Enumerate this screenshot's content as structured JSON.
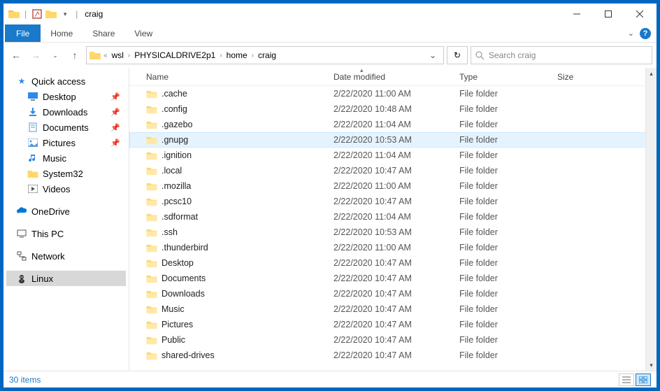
{
  "title": "craig",
  "ribbon": {
    "file": "File",
    "home": "Home",
    "share": "Share",
    "view": "View"
  },
  "breadcrumbs": [
    "wsl",
    "PHYSICALDRIVE2p1",
    "home",
    "craig"
  ],
  "search_placeholder": "Search craig",
  "columns": {
    "name": "Name",
    "date": "Date modified",
    "type": "Type",
    "size": "Size"
  },
  "nav": {
    "quick": "Quick access",
    "quick_items": [
      {
        "label": "Desktop",
        "pin": true,
        "icon": "desktop"
      },
      {
        "label": "Downloads",
        "pin": true,
        "icon": "downloads"
      },
      {
        "label": "Documents",
        "pin": true,
        "icon": "documents"
      },
      {
        "label": "Pictures",
        "pin": true,
        "icon": "pictures"
      },
      {
        "label": "Music",
        "pin": false,
        "icon": "music"
      },
      {
        "label": "System32",
        "pin": false,
        "icon": "folder"
      },
      {
        "label": "Videos",
        "pin": false,
        "icon": "videos"
      }
    ],
    "onedrive": "OneDrive",
    "thispc": "This PC",
    "network": "Network",
    "linux": "Linux"
  },
  "files": [
    {
      "name": ".cache",
      "date": "2/22/2020 11:00 AM",
      "type": "File folder"
    },
    {
      "name": ".config",
      "date": "2/22/2020 10:48 AM",
      "type": "File folder"
    },
    {
      "name": ".gazebo",
      "date": "2/22/2020 11:04 AM",
      "type": "File folder"
    },
    {
      "name": ".gnupg",
      "date": "2/22/2020 10:53 AM",
      "type": "File folder",
      "hover": true
    },
    {
      "name": ".ignition",
      "date": "2/22/2020 11:04 AM",
      "type": "File folder"
    },
    {
      "name": ".local",
      "date": "2/22/2020 10:47 AM",
      "type": "File folder"
    },
    {
      "name": ".mozilla",
      "date": "2/22/2020 11:00 AM",
      "type": "File folder"
    },
    {
      "name": ".pcsc10",
      "date": "2/22/2020 10:47 AM",
      "type": "File folder"
    },
    {
      "name": ".sdformat",
      "date": "2/22/2020 11:04 AM",
      "type": "File folder"
    },
    {
      "name": ".ssh",
      "date": "2/22/2020 10:53 AM",
      "type": "File folder"
    },
    {
      "name": ".thunderbird",
      "date": "2/22/2020 11:00 AM",
      "type": "File folder"
    },
    {
      "name": "Desktop",
      "date": "2/22/2020 10:47 AM",
      "type": "File folder"
    },
    {
      "name": "Documents",
      "date": "2/22/2020 10:47 AM",
      "type": "File folder"
    },
    {
      "name": "Downloads",
      "date": "2/22/2020 10:47 AM",
      "type": "File folder"
    },
    {
      "name": "Music",
      "date": "2/22/2020 10:47 AM",
      "type": "File folder"
    },
    {
      "name": "Pictures",
      "date": "2/22/2020 10:47 AM",
      "type": "File folder"
    },
    {
      "name": "Public",
      "date": "2/22/2020 10:47 AM",
      "type": "File folder"
    },
    {
      "name": "shared-drives",
      "date": "2/22/2020 10:47 AM",
      "type": "File folder"
    }
  ],
  "status": "30 items"
}
